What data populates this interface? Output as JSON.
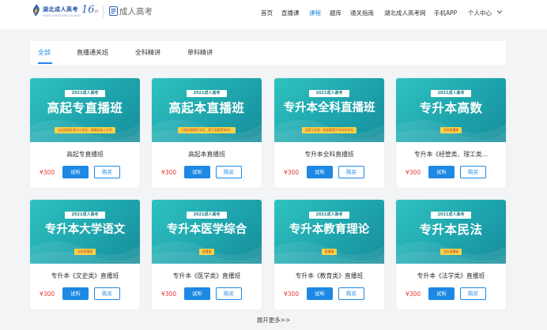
{
  "header": {
    "logo_title": "湖北成人高考",
    "logo_sub": "HUBEI CHENGREN GAOKAO",
    "logo_badge": "16",
    "logo_badge_sub": "th",
    "brand2_text": "成人高考",
    "nav": [
      {
        "label": "首页",
        "active": false
      },
      {
        "label": "直播课",
        "active": false
      },
      {
        "label": "课程",
        "active": true
      },
      {
        "label": "题库",
        "active": false
      },
      {
        "label": "通关指南",
        "active": false
      },
      {
        "label": "湖北成人高考网",
        "active": false
      },
      {
        "label": "手机APP",
        "active": false
      },
      {
        "label": "个人中心",
        "active": false
      }
    ],
    "accent": "#1e88e5"
  },
  "tabs": [
    {
      "label": "全部",
      "active": true
    },
    {
      "label": "直播通关班",
      "active": false
    },
    {
      "label": "全科精讲",
      "active": false
    },
    {
      "label": "单科精讲",
      "active": false
    }
  ],
  "courses": [
    {
      "top": "2021成人高考",
      "title": "高起专直播班",
      "strip": "无论你现在是什么学历，都能轻松入大学",
      "name": "高起专直播班",
      "price": "¥300",
      "try": "试听",
      "buy": "购买"
    },
    {
      "top": "2021成人高考",
      "title": "高起本直播班",
      "strip": "只要你想提升学历，那下面就是你的！",
      "name": "高起本直播班",
      "price": "¥300",
      "try": "试听",
      "buy": "购买"
    },
    {
      "top": "2021成人高考",
      "title": "专升本全科直播班",
      "strip": "适用于在职一般想要提升学历的学员",
      "name": "专升本全科直播班",
      "price": "¥300",
      "try": "试听",
      "buy": "购买"
    },
    {
      "top": "2021成人高考",
      "title": "专升本高数",
      "strip": "全科直播课",
      "name": "专升本《经管类、理工类...",
      "price": "¥300",
      "try": "试听",
      "buy": "购买"
    },
    {
      "top": "2021成人高考",
      "title": "专升本大学语文",
      "strip": "全科直播课",
      "name": "专升本《文史类》直播班",
      "price": "¥300",
      "try": "试听",
      "buy": "购买"
    },
    {
      "top": "2021成人高考",
      "title": "专升本医学综合",
      "strip": "直播课",
      "name": "专升本《医学类》直播班",
      "price": "¥300",
      "try": "试听",
      "buy": "购买"
    },
    {
      "top": "2021成人高考",
      "title": "专升本教育理论",
      "strip": "直播课",
      "name": "专升本《教育类》直播班",
      "price": "¥300",
      "try": "试听",
      "buy": "购买"
    },
    {
      "top": "2021成人高考",
      "title": "专升本民法",
      "strip": "全科直播课",
      "name": "专升本《法学类》直播班",
      "price": "¥300",
      "try": "试听",
      "buy": "购买"
    }
  ],
  "more_label": "展开更多>>"
}
